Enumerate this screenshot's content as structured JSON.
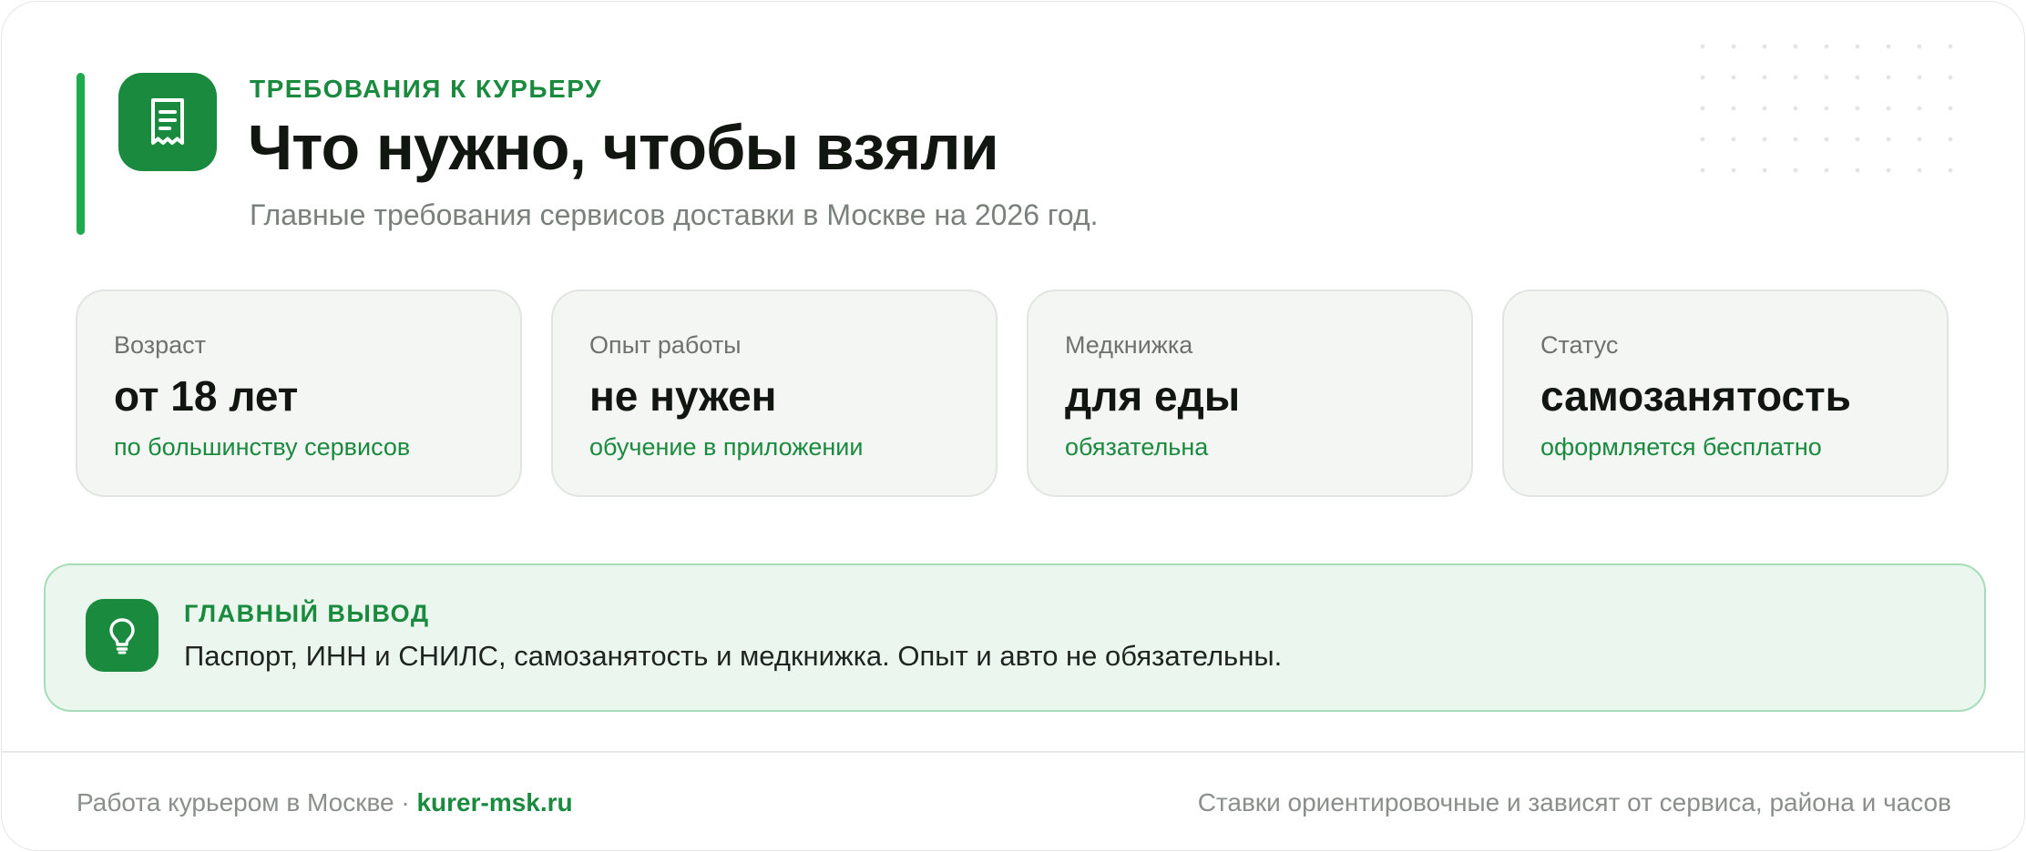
{
  "header": {
    "eyebrow": "ТРЕБОВАНИЯ К КУРЬЕРУ",
    "title": "Что нужно, чтобы взяли",
    "subtitle": "Главные требования сервисов доставки в Москве на 2026 год.",
    "icon": "receipt-icon"
  },
  "stats": [
    {
      "label": "Возраст",
      "value": "от 18 лет",
      "note": "по большинству сервисов"
    },
    {
      "label": "Опыт работы",
      "value": "не нужен",
      "note": "обучение в приложении"
    },
    {
      "label": "Медкнижка",
      "value": "для еды",
      "note": "обязательна"
    },
    {
      "label": "Статус",
      "value": "самозанятость",
      "note": "оформляется бесплатно"
    }
  ],
  "takeaway": {
    "heading": "ГЛАВНЫЙ ВЫВОД",
    "text": "Паспорт, ИНН и СНИЛС, самозанятость и медкнижка. Опыт и авто не обязательны.",
    "icon": "lightbulb-icon"
  },
  "footer": {
    "left_text": "Работа курьером в Москве · ",
    "site": "kurer-msk.ru",
    "right_text": "Ставки ориентировочные и зависят от сервиса, района и часов"
  },
  "colors": {
    "accent": "#198a3e",
    "accent_bar": "#1faa4e",
    "takeaway_bg": "#eaf6ee",
    "card_bg": "#f4f6f4"
  }
}
